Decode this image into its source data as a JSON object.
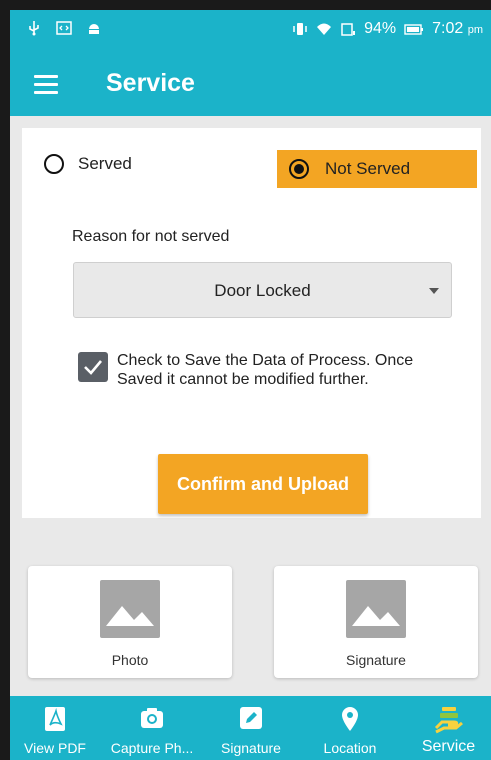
{
  "status_bar": {
    "battery": "94%",
    "time": "7:02",
    "ampm": "pm"
  },
  "app_bar": {
    "title": "Service"
  },
  "service_form": {
    "radio_served_label": "Served",
    "radio_not_served_label": "Not Served",
    "selected": "Not Served",
    "reason_label": "Reason for not served",
    "reason_value": "Door Locked",
    "checkbox_checked": true,
    "checkbox_text": "Check to Save the Data of Process. Once Saved it cannot be modified further.",
    "confirm_label": "Confirm and Upload"
  },
  "tiles": {
    "photo_label": "Photo",
    "signature_label": "Signature"
  },
  "bottom_nav": {
    "items": [
      {
        "label": "View PDF",
        "icon": "pdf-icon"
      },
      {
        "label": "Capture Ph...",
        "icon": "camera-icon"
      },
      {
        "label": "Signature",
        "icon": "pen-icon"
      },
      {
        "label": "Location",
        "icon": "location-pin-icon"
      },
      {
        "label": "Service",
        "icon": "service-hand-icon"
      }
    ],
    "active": "Service"
  },
  "colors": {
    "primary": "#1bb3c9",
    "accent": "#f3a523"
  }
}
